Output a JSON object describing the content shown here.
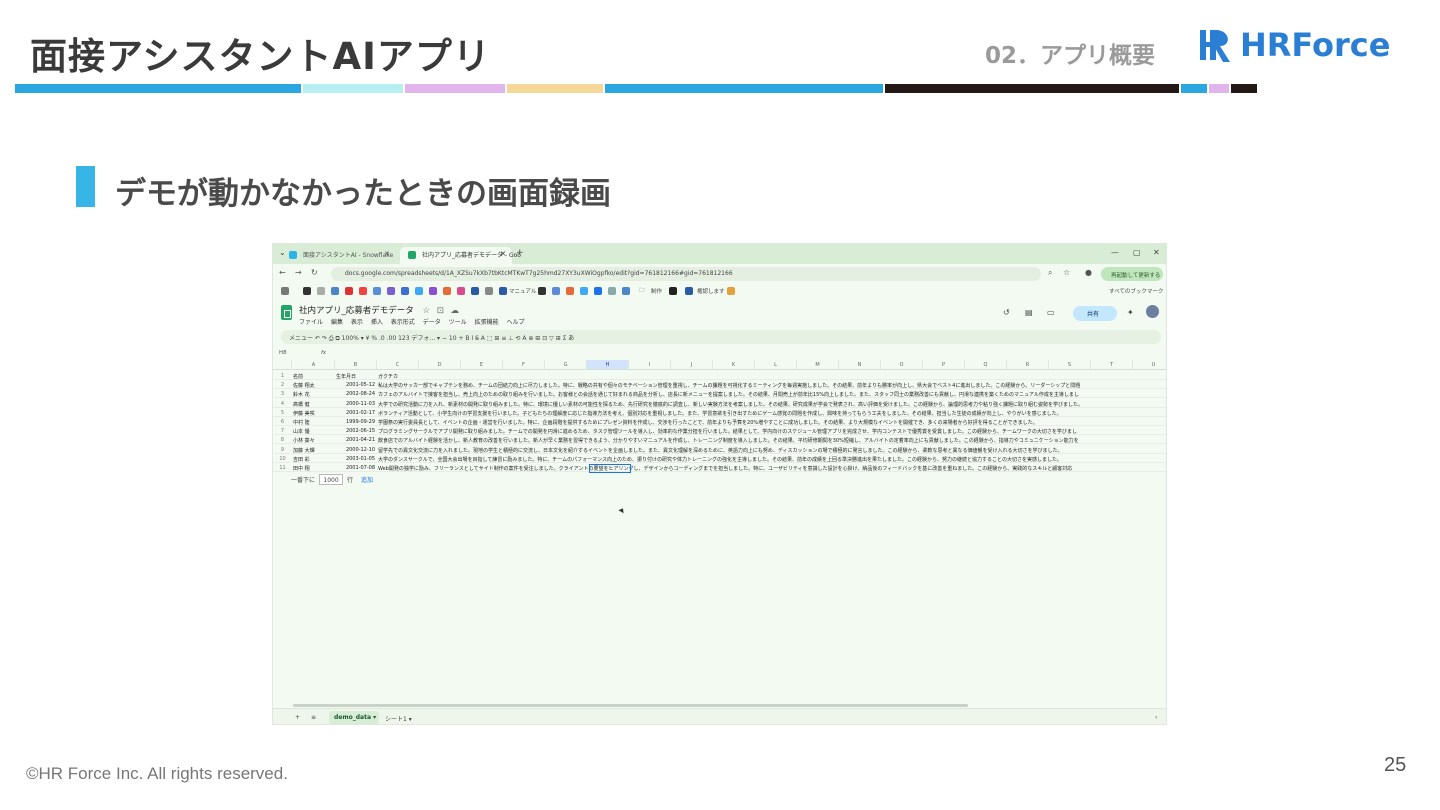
{
  "slide": {
    "title": "面接アシスタントAIアプリ",
    "section": "02．アプリ概要",
    "logo_text": "HRForce",
    "subtitle": "デモが動かなかったときの画面録画",
    "copyright": "©HR Force Inc. All rights reserved.",
    "page_number": "25",
    "band_colors": [
      "#2aa6e0",
      "#b7eef2",
      "#e2b4ec",
      "#f5d79a",
      "#2aa6e0",
      "#231815",
      "#2aa6e0",
      "#e2b4ec",
      "#231815"
    ],
    "accent": "#36b5e6"
  },
  "browser": {
    "tabs": [
      {
        "label": "面接アシスタントAI - Snowflake",
        "active": false
      },
      {
        "label": "社内アプリ_応募者デモデータ - Goo",
        "active": true
      }
    ],
    "url": "docs.google.com/spreadsheets/d/1A_XZSu7kXb7tbKtcMTKwT7g25hmd27XY3uXWiOgpfko/edit?gid=761812166#gid=761812166",
    "relaunch_label": "再起動して更新する",
    "bookmarks": [
      "マニュアル",
      "制作",
      "権認します",
      "すべてのブックマーク"
    ]
  },
  "sheet": {
    "doc_title": "社内アプリ_応募者デモデータ",
    "menu": [
      "ファイル",
      "編集",
      "表示",
      "挿入",
      "表示形式",
      "データ",
      "ツール",
      "拡張機能",
      "ヘルプ"
    ],
    "share_label": "共有",
    "toolbar": "メニュー   ↶  ↷  ⎙  ⧉   100%  ▾   ¥   %   .0   .00   123   デフォ...  ▾   −  10  +   B   I   S̶   A   ⬚   ⊞   ≡   ⊥   ⟲   A   ⊕   ⊞   ⊡   ▽   ⊞   Σ   あ",
    "name_box": "H8",
    "fx": "fx",
    "columns": [
      "A",
      "B",
      "C",
      "D",
      "E",
      "F",
      "G",
      "H",
      "I",
      "J",
      "K",
      "L",
      "M",
      "N",
      "O",
      "P",
      "Q",
      "R",
      "S",
      "T",
      "U"
    ],
    "header_row": {
      "name": "名前",
      "dob": "生年月日",
      "gk": "ガクチカ"
    },
    "rows": [
      {
        "name": "佐藤 翔太",
        "dob": "2001-05-12",
        "gk": "私は大学のサッカー部でキャプテンを務め、チームの団結力向上に尽力しました。特に、戦略の共有や個々のモチベーション管理を重視し、チームの課題を可視化するミーティングを毎週実施しました。その結果、前年よりも勝率が向上し、県大会でベスト4に進出しました。この経験から、リーダーシップと問題"
      },
      {
        "name": "鈴木 花",
        "dob": "2002-08-24",
        "gk": "カフェのアルバイトで接客を担当し、売上向上のための取り組みを行いました。お客様との会話を通じて好まれる商品を分析し、店長に新メニューを提案しました。その結果、月間売上が前年比15%向上しました。また、スタッフ同士の業務改善にも貢献し、円滑な連携を築くためのマニュアル作成を主導しまし"
      },
      {
        "name": "髙橋 健",
        "dob": "2000-11-03",
        "gk": "大学での研究活動に力を入れ、新素材の開発に取り組みました。特に、環境に優しい素材の可能性を探るため、先行研究を徹底的に調査し、新しい実験方法を考案しました。その結果、研究成果が学会で発表され、高い評価を受けました。この経験から、論理的思考力や粘り強く課題に取り組む姿勢を学びました。"
      },
      {
        "name": "伊藤 美咲",
        "dob": "2001-02-17",
        "gk": "ボランティア活動として、小学生向けの学習支援を行いました。子どもたちの理解度に応じた指導方法を考え、個別対応を重視しました。また、学習意欲を引き出すためにゲーム感覚の問題を作成し、興味を持ってもらう工夫をしました。その結果、担当した生徒の成績が向上し、やりがいを感じました。"
      },
      {
        "name": "中村 陸",
        "dob": "1999-09-29",
        "gk": "学園祭の実行委員長として、イベントの企画・運営を行いました。特に、企画段階を提供するためにプレゼン資料を作成し、交渉を行ったことで、前年よりも予算を20%増やすことに成功しました。その結果、より大規模なイベントを開催でき、多くの来場者から好評を得ることができました。"
      },
      {
        "name": "山本 優",
        "dob": "2002-06-15",
        "gk": "プログラミングサークルでアプリ開発に取り組みました。チームでの開発を円滑に進めるため、タスク管理ツールを導入し、効率的な作業分担を行いました。結果として、学内向けのスケジュール管理アプリを完成させ、学内コンテストで優秀賞を受賞しました。この経験から、チームワークの大切さを学びまし"
      },
      {
        "name": "小林 葵々",
        "dob": "2001-04-21",
        "gk": "飲食店でのアルバイト経験を活かし、新人教育の改善を行いました。新人が早く業務を習得できるよう、分かりやすいマニュアルを作成し、トレーニング制度を導入しました。その結果、平均研修期間を30%短縮し、アルバイトの定着率向上にも貢献しました。この経験から、指導力やコミュニケーション能力を"
      },
      {
        "name": "加藤 大輝",
        "dob": "2000-12-10",
        "gk": "留学先での異文化交流に力を入れました。現地の学生と積極的に交流し、日本文化を紹介するイベントを企画しました。また、異文化理解を深めるために、英語力向上にも努め、ディスカッションの場で積極的に発言しました。この経験から、柔軟な思考と異なる価値観を受け入れる大切さを学びました。"
      },
      {
        "name": "吉田 彩",
        "dob": "2003-01-05",
        "gk": "大学のダンスサークルで、全国大会出場を目指して練習に励みました。特に、チームのパフォーマンス向上のため、振り付けの研究や体力トレーニングの強化を主導しました。その結果、前年の成績を上回る準決勝進出を果たしました。この経験から、努力の継続と協力することの大切さを実感しました。"
      },
      {
        "name": "田中 翔",
        "dob": "2001-07-08",
        "gk": "Web開発の独学に励み、フリーランスとしてサイト制作の案件を受注しました。クライアントの要望をヒアリングし、デザインからコーディングまでを担当しました。特に、ユーザビリティを意識した設計を心掛け、納品後のフィードバックを基に改善を重ねました。この経験から、実践的なスキルと顧客対応"
      }
    ],
    "add_rows": {
      "prefix": "一番下に",
      "value": "1000",
      "unit": "行",
      "link": "追加"
    },
    "sheet_tabs": [
      "demo_data",
      "シート1"
    ]
  }
}
